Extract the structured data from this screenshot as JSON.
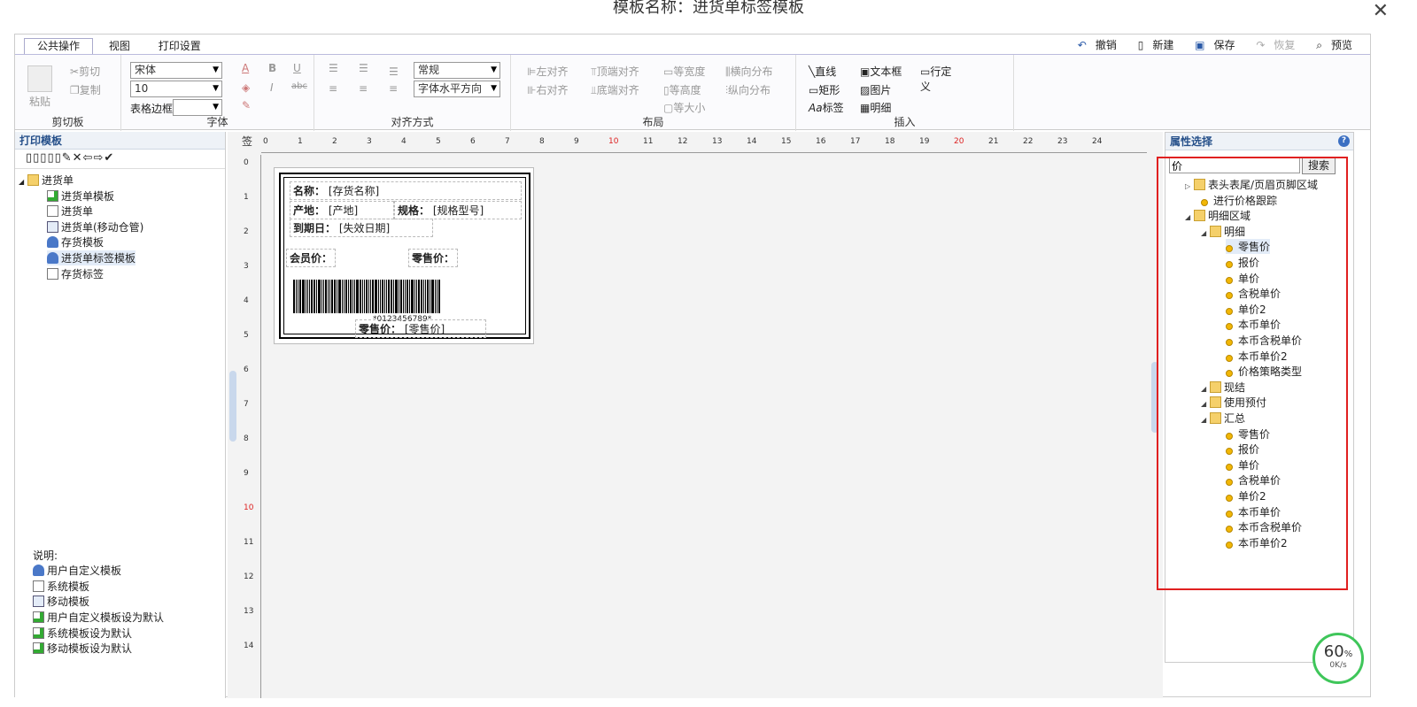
{
  "window": {
    "title": "模板名称：进货单标签模板",
    "close_icon": "✕"
  },
  "tabs": [
    {
      "label": "公共操作"
    },
    {
      "label": "视图"
    },
    {
      "label": "打印设置"
    }
  ],
  "quick_actions": {
    "undo": "撤销",
    "new": "新建",
    "save": "保存",
    "redo": "恢复",
    "preview": "预览"
  },
  "ribbon": {
    "clipboard": {
      "paste": "粘贴",
      "cut": "剪切",
      "copy": "复制",
      "label": "剪切板"
    },
    "font": {
      "family": "宋体",
      "size": "10",
      "table_border": "表格边框",
      "label": "字体",
      "A": "A",
      "B": "B",
      "U": "U",
      "I": "I",
      "abc": "abc"
    },
    "align": {
      "style": "常规",
      "horizontal": "字体水平方向",
      "label": "对齐方式"
    },
    "layout": {
      "left_align": "左对齐",
      "right_align": "右对齐",
      "top_align": "顶端对齐",
      "bottom_align": "底端对齐",
      "equal_width": "等宽度",
      "equal_height": "等高度",
      "equal_size": "等大小",
      "h_distribute": "横向分布",
      "v_distribute": "纵向分布",
      "label": "布局"
    },
    "insert": {
      "line": "直线",
      "textbox": "文本框",
      "custom_row": "行定义",
      "rect": "矩形",
      "image": "图片",
      "label_item": "标签",
      "detail": "明细",
      "label": "插入"
    }
  },
  "left_panel": {
    "title": "打印模板",
    "toolbar_icons": "▯▯▯▯▯✎✕⇦⇨✔",
    "tree": [
      {
        "label": "进货单",
        "icon": "folder"
      },
      {
        "label": "进货单模板",
        "icon": "ok"
      },
      {
        "label": "进货单",
        "icon": "doc"
      },
      {
        "label": "进货单(移动仓管)",
        "icon": "mob"
      },
      {
        "label": "存货模板",
        "icon": "user"
      },
      {
        "label": "进货单标签模板",
        "icon": "user"
      },
      {
        "label": "存货标签",
        "icon": "doc"
      }
    ],
    "legend_title": "说明:",
    "legend": [
      {
        "label": "用户自定义模板",
        "icon": "user"
      },
      {
        "label": "系统模板",
        "icon": "doc"
      },
      {
        "label": "移动模板",
        "icon": "mob"
      },
      {
        "label": "用户自定义模板设为默认",
        "icon": "ok"
      },
      {
        "label": "系统模板设为默认",
        "icon": "ok"
      },
      {
        "label": "移动模板设为默认",
        "icon": "ok"
      }
    ]
  },
  "canvas": {
    "corner": "签",
    "h_ruler": [
      "0",
      "1",
      "2",
      "3",
      "4",
      "5",
      "6",
      "7",
      "8",
      "9",
      "10",
      "11",
      "12",
      "13",
      "14",
      "15",
      "16",
      "17",
      "18",
      "19",
      "20",
      "21",
      "22",
      "23",
      "24"
    ],
    "v_ruler": [
      "0",
      "1",
      "2",
      "3",
      "4",
      "5",
      "6",
      "7",
      "8",
      "9",
      "10",
      "11",
      "12",
      "13",
      "14"
    ],
    "label": {
      "name_label": "名称：",
      "name_value": "[存货名称]",
      "origin_label": "产地：",
      "origin_value": "[产地]",
      "spec_label": "规格：",
      "spec_value": "[规格型号]",
      "expiry_label": "到期日：",
      "expiry_value": "[失效日期]",
      "member_price_label": "会员价：",
      "retail_price_label": "零售价：",
      "barcode_text": "*0123456789*",
      "retail_label_2": "零售价：",
      "retail_value": "[零售价]"
    }
  },
  "right_panel": {
    "title": "属性选择",
    "help_icon": "?",
    "search_value": "价",
    "search_button": "搜索",
    "tree": [
      {
        "label": "表头表尾/页眉页脚区域",
        "level": 1,
        "type": "folder",
        "arrow": "▷"
      },
      {
        "label": "进行价格跟踪",
        "level": 2,
        "type": "bullet"
      },
      {
        "label": "明细区域",
        "level": 1,
        "type": "folder",
        "arrow": "◢"
      },
      {
        "label": "明细",
        "level": 2,
        "type": "folder",
        "arrow": "◢"
      },
      {
        "label": "零售价",
        "level": 3,
        "type": "bullet",
        "selected": true
      },
      {
        "label": "报价",
        "level": 3,
        "type": "bullet"
      },
      {
        "label": "单价",
        "level": 3,
        "type": "bullet"
      },
      {
        "label": "含税单价",
        "level": 3,
        "type": "bullet"
      },
      {
        "label": "单价2",
        "level": 3,
        "type": "bullet"
      },
      {
        "label": "本币单价",
        "level": 3,
        "type": "bullet"
      },
      {
        "label": "本币含税单价",
        "level": 3,
        "type": "bullet"
      },
      {
        "label": "本币单价2",
        "level": 3,
        "type": "bullet"
      },
      {
        "label": "价格策略类型",
        "level": 3,
        "type": "bullet"
      },
      {
        "label": "现结",
        "level": 2,
        "type": "folder",
        "arrow": "◢"
      },
      {
        "label": "使用预付",
        "level": 2,
        "type": "folder",
        "arrow": "◢"
      },
      {
        "label": "汇总",
        "level": 2,
        "type": "folder",
        "arrow": "◢"
      },
      {
        "label": "零售价",
        "level": 3,
        "type": "bullet"
      },
      {
        "label": "报价",
        "level": 3,
        "type": "bullet"
      },
      {
        "label": "单价",
        "level": 3,
        "type": "bullet"
      },
      {
        "label": "含税单价",
        "level": 3,
        "type": "bullet"
      },
      {
        "label": "单价2",
        "level": 3,
        "type": "bullet"
      },
      {
        "label": "本币单价",
        "level": 3,
        "type": "bullet"
      },
      {
        "label": "本币含税单价",
        "level": 3,
        "type": "bullet"
      },
      {
        "label": "本币单价2",
        "level": 3,
        "type": "bullet"
      }
    ]
  },
  "speed_widget": {
    "percent": "60",
    "unit": "%",
    "rate": "0K/s"
  },
  "colors": {
    "highlight_box": "#e02020",
    "panel_header": "#26508a",
    "speed_ring": "#3fc65a"
  }
}
